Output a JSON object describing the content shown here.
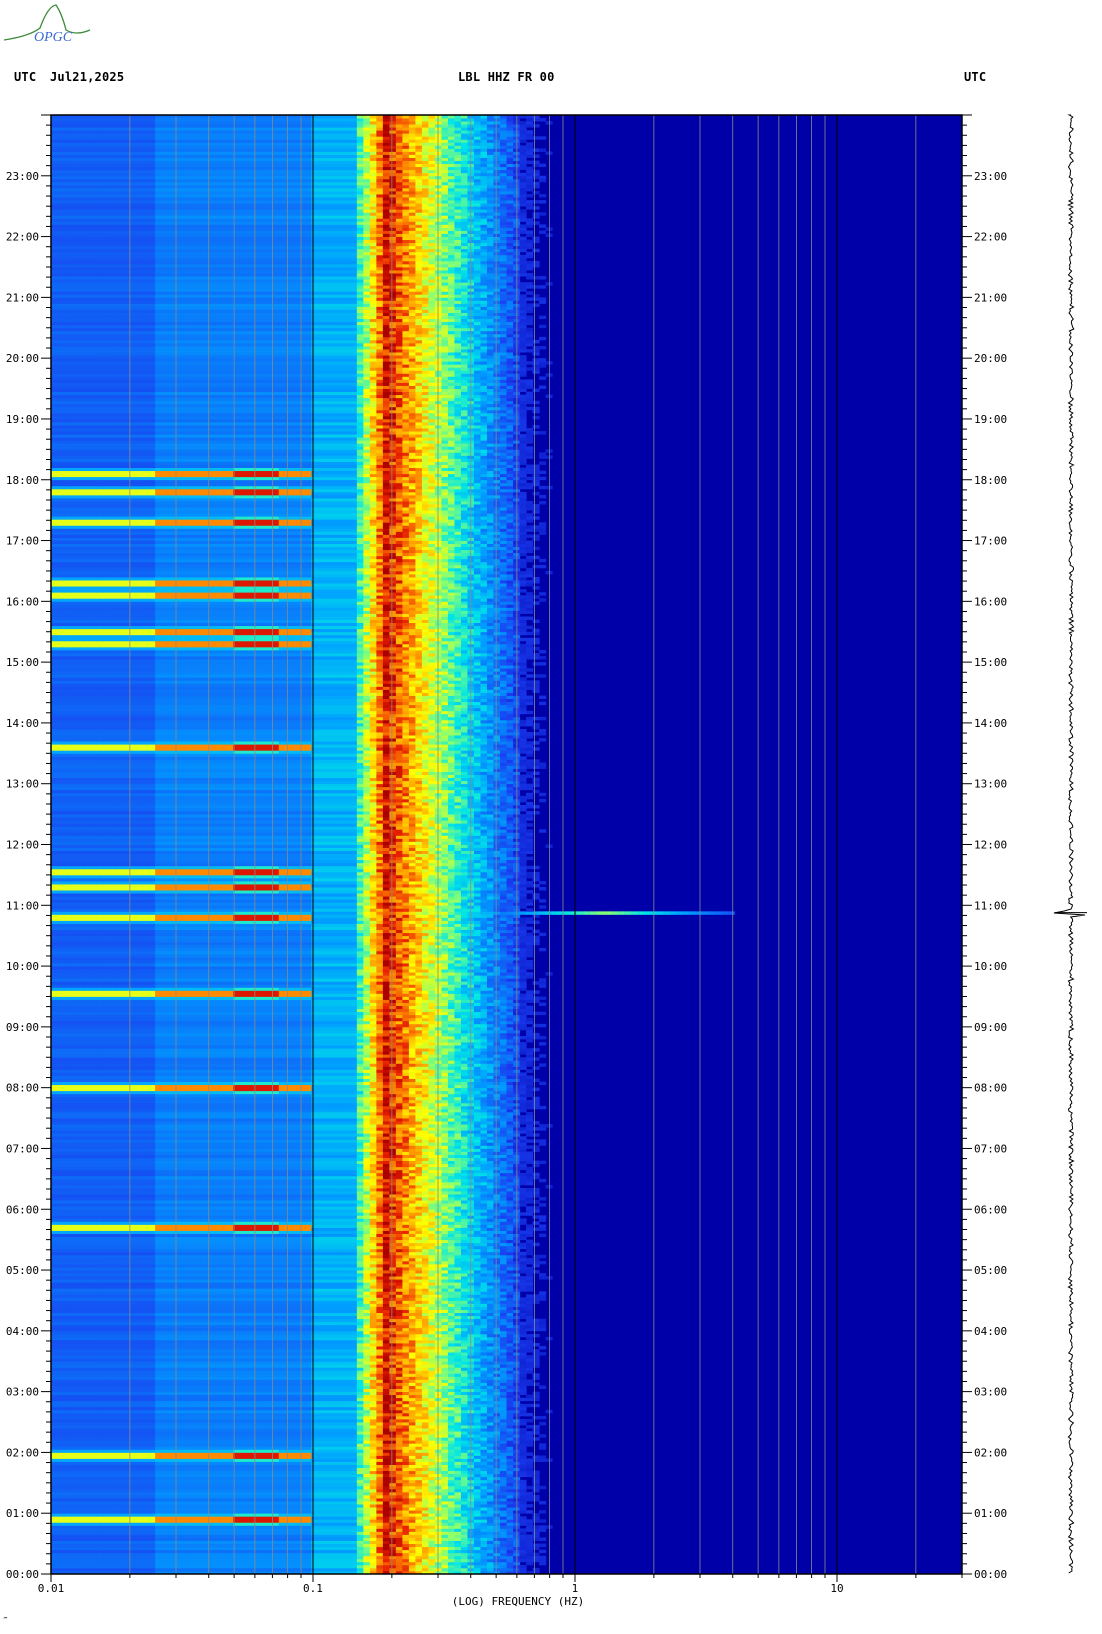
{
  "header": {
    "left_utc": "UTC",
    "date": "Jul21,2025",
    "station": "LBL HHZ FR 00",
    "right_utc": "UTC"
  },
  "logo": {
    "text": "OPGC",
    "color": "#3a8a3a"
  },
  "footer_mark": "‴",
  "chart_data": {
    "type": "heatmap",
    "title": "LBL HHZ FR 00",
    "xlabel": "(LOG) FREQUENCY (HZ)",
    "ylabel": "",
    "x_scale": "log",
    "xlim": [
      0.01,
      30
    ],
    "x_tick_labels": [
      {
        "value": 0.01,
        "label": "0.01"
      },
      {
        "value": 0.1,
        "label": "0.1"
      },
      {
        "value": 1,
        "label": "1"
      },
      {
        "value": 10,
        "label": "10"
      }
    ],
    "ylim_hours": [
      0,
      24
    ],
    "y_tick_labels": [
      "00:00",
      "01:00",
      "02:00",
      "03:00",
      "04:00",
      "05:00",
      "06:00",
      "07:00",
      "08:00",
      "09:00",
      "10:00",
      "11:00",
      "12:00",
      "13:00",
      "14:00",
      "15:00",
      "16:00",
      "17:00",
      "18:00",
      "19:00",
      "20:00",
      "21:00",
      "22:00",
      "23:00"
    ],
    "colors": {
      "background": "#0000a8",
      "low": "#1a3cf0",
      "mid": "#00d0ff",
      "high_yellow": "#ffff00",
      "high_orange": "#ff7f00",
      "peak": "#b40000"
    },
    "microseism_band_hz": [
      0.15,
      0.5
    ],
    "microseism_peak_hz": [
      0.17,
      0.21
    ],
    "event_hour": 10.88,
    "event_freq_hz": [
      0.4,
      4
    ],
    "long_period_bursts_hours": [
      0.9,
      1.95,
      5.7,
      8.0,
      9.55,
      10.8,
      11.3,
      11.55,
      13.6,
      15.3,
      15.5,
      16.1,
      16.3,
      17.3,
      17.8,
      18.1
    ],
    "grid": true
  }
}
